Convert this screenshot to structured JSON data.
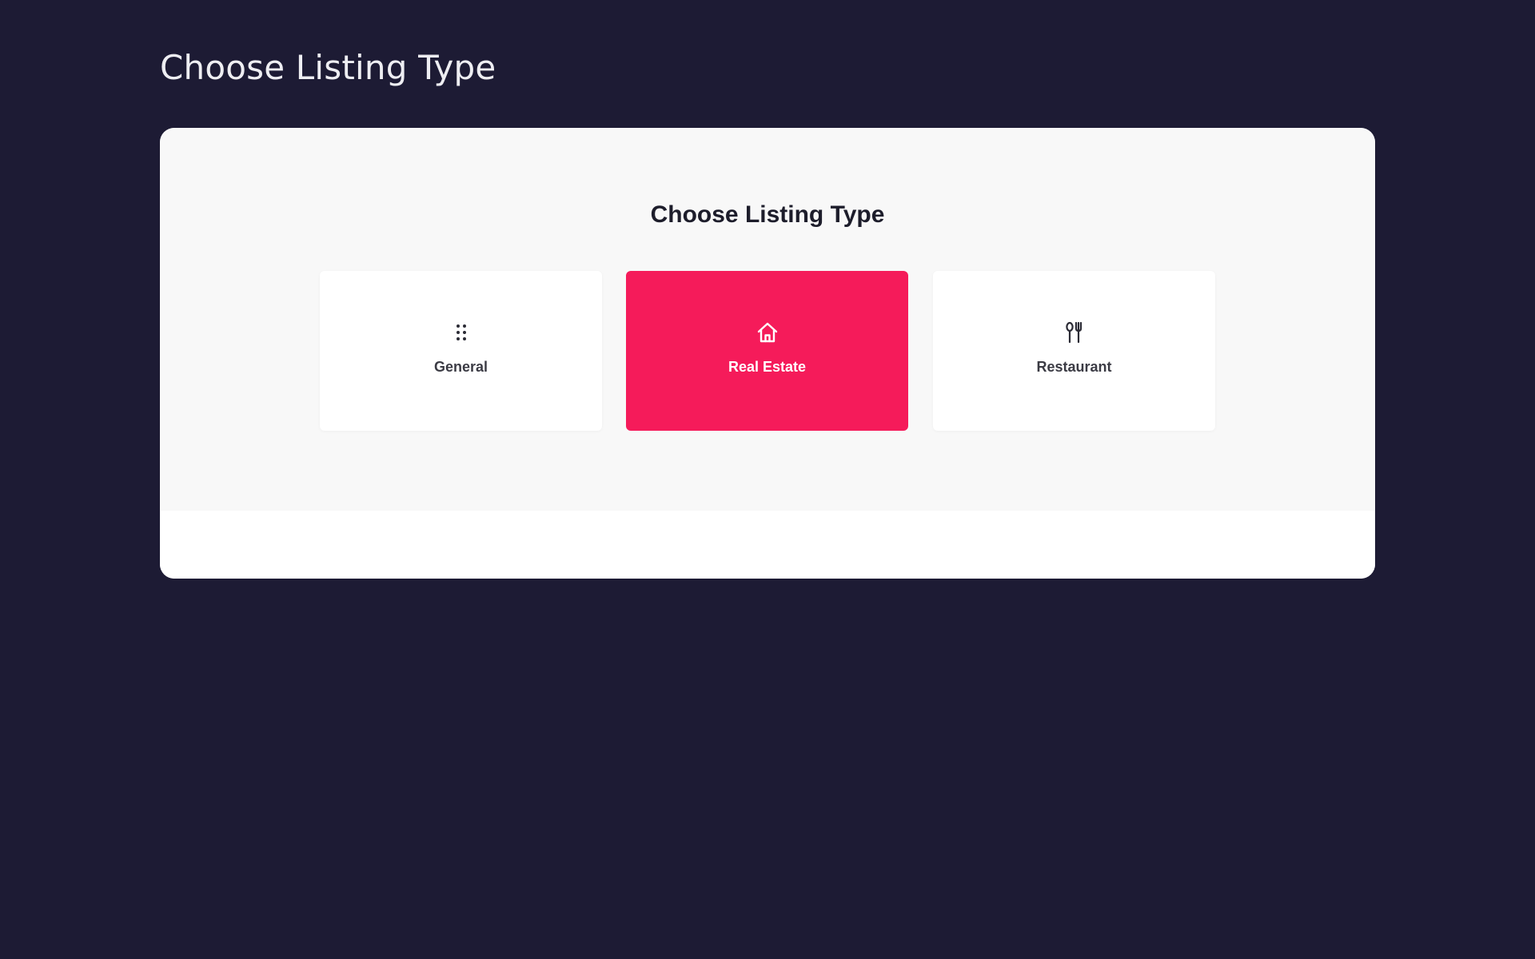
{
  "page": {
    "title": "Choose Listing Type"
  },
  "panel": {
    "heading": "Choose Listing Type",
    "selected_type": "Real Estate",
    "types": [
      {
        "label": "General",
        "icon": "dots-grid-icon",
        "selected": false
      },
      {
        "label": "Real Estate",
        "icon": "home-icon",
        "selected": true
      },
      {
        "label": "Restaurant",
        "icon": "utensils-icon",
        "selected": false
      }
    ]
  },
  "colors": {
    "background": "#1d1b34",
    "panel": "#ffffff",
    "panel_body": "#f8f8f8",
    "accent": "#f51b5a",
    "text_dark": "#1d1d2b"
  }
}
